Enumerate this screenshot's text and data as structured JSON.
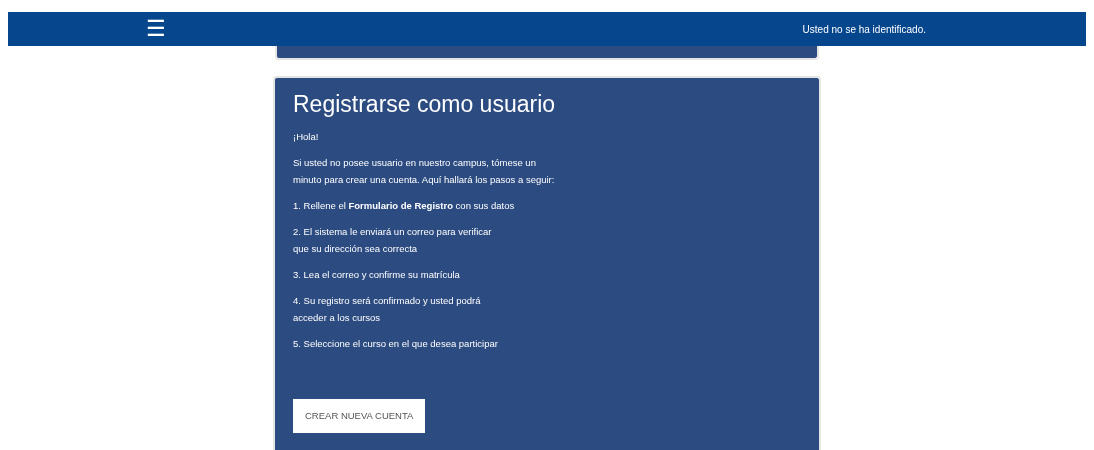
{
  "navbar": {
    "menu_icon": "☰",
    "login_status": "Usted no se ha identificado."
  },
  "card": {
    "title": "Registrarse como usuario",
    "paragraphs": [
      "¡Hola!",
      "Si usted no posee usuario en nuestro campus, tómese un\nminuto para crear una cuenta. Aquí hallará los pasos a seguir:",
      "1. Rellene el **Formulario de Registro** con sus datos",
      "2. El sistema le enviará un correo para verificar\nque su dirección sea correcta",
      "3. Lea el correo y confirme su matrícula",
      "4. Su registro será confirmado y usted podrá\nacceder a los cursos",
      "5. Seleccione el curso en el que desea participar"
    ],
    "button": "CREAR NUEVA CUENTA"
  }
}
